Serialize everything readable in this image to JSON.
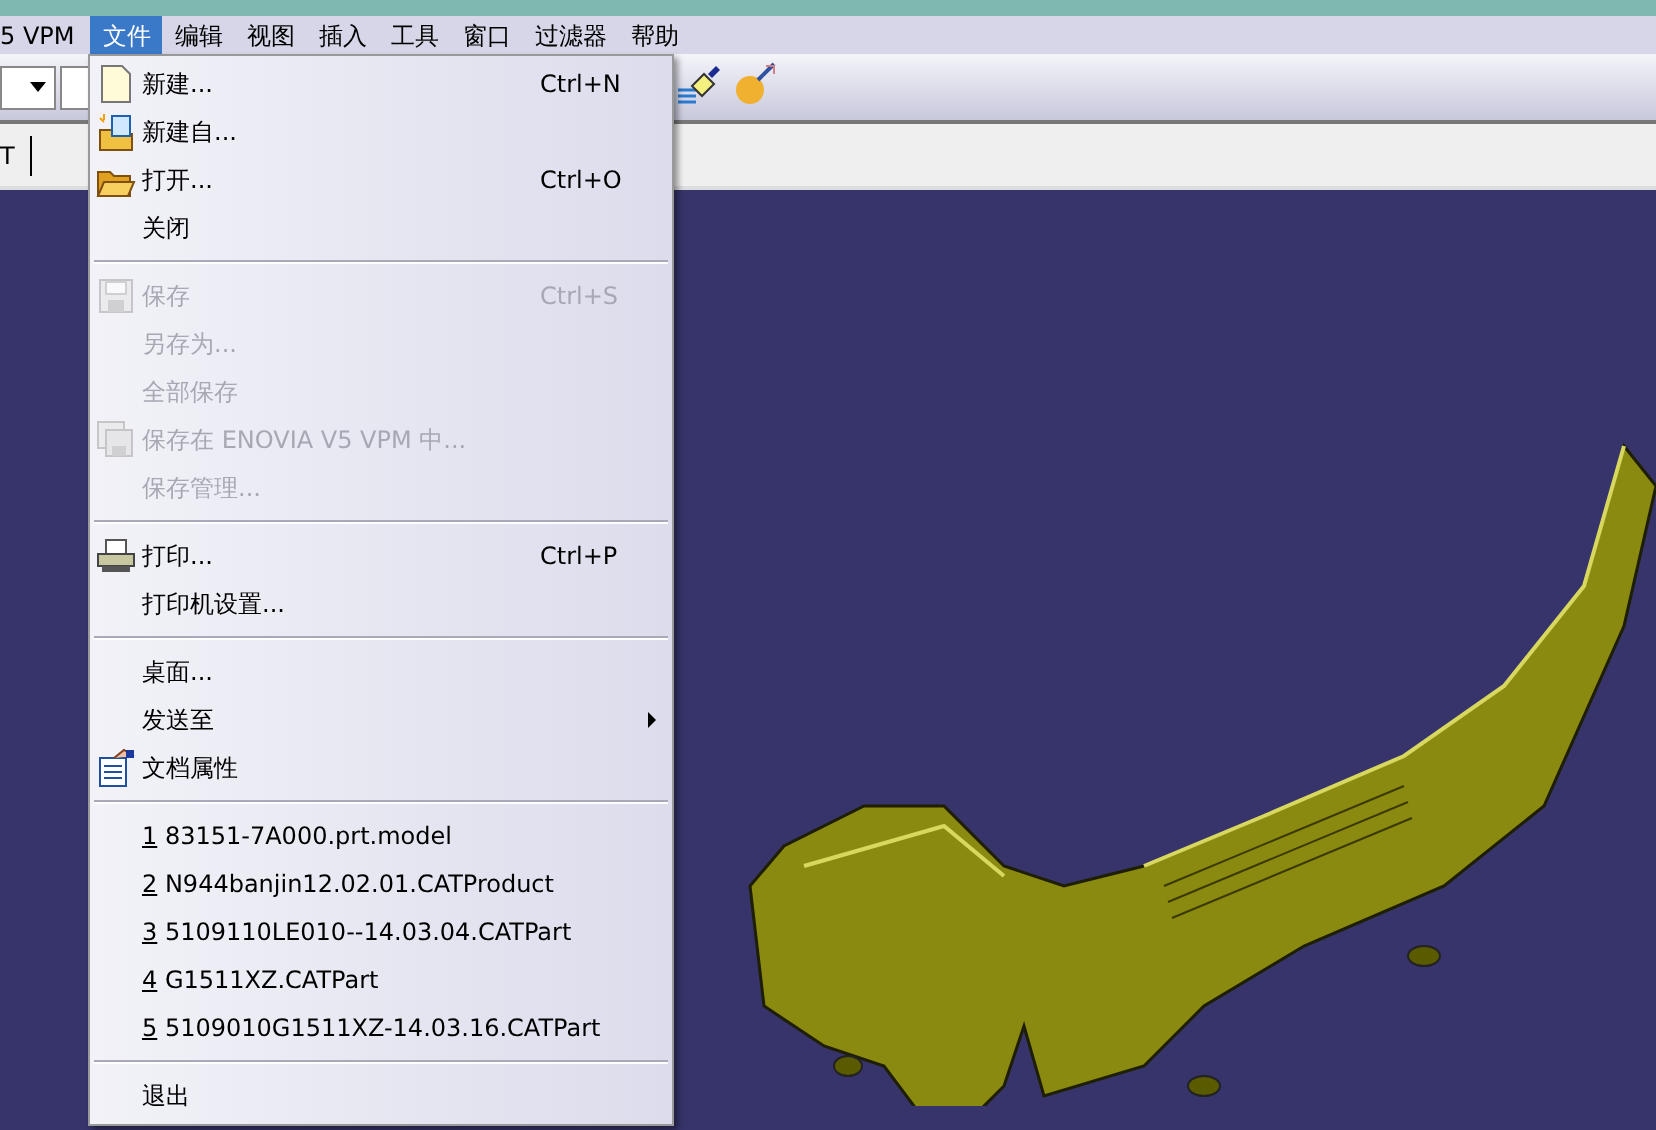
{
  "menu_bar": {
    "leading_text": "5 VPM",
    "menus": [
      {
        "label": "文件",
        "selected": true
      },
      {
        "label": "编辑",
        "selected": false
      },
      {
        "label": "视图",
        "selected": false
      },
      {
        "label": "插入",
        "selected": false
      },
      {
        "label": "工具",
        "selected": false
      },
      {
        "label": "窗口",
        "selected": false
      },
      {
        "label": "过滤器",
        "selected": false
      },
      {
        "label": "帮助",
        "selected": false
      }
    ]
  },
  "second_toolbar": {
    "text": "T"
  },
  "file_menu": {
    "items": [
      {
        "kind": "item",
        "label": "新建...",
        "shortcut": "Ctrl+N",
        "disabled": false
      },
      {
        "kind": "item",
        "label": "新建自...",
        "disabled": false
      },
      {
        "kind": "item",
        "label": "打开...",
        "shortcut": "Ctrl+O",
        "disabled": false
      },
      {
        "kind": "item",
        "label": "关闭",
        "disabled": false
      },
      {
        "kind": "separator"
      },
      {
        "kind": "item",
        "label": "保存",
        "shortcut": "Ctrl+S",
        "disabled": true
      },
      {
        "kind": "item",
        "label": "另存为...",
        "disabled": true
      },
      {
        "kind": "item",
        "label": "全部保存",
        "disabled": true
      },
      {
        "kind": "item",
        "label": "保存在 ENOVIA V5 VPM 中...",
        "disabled": true
      },
      {
        "kind": "item",
        "label": "保存管理...",
        "disabled": true
      },
      {
        "kind": "separator"
      },
      {
        "kind": "item",
        "label": "打印...",
        "shortcut": "Ctrl+P",
        "disabled": false
      },
      {
        "kind": "item",
        "label": "打印机设置...",
        "disabled": false
      },
      {
        "kind": "separator"
      },
      {
        "kind": "item",
        "label": "桌面...",
        "disabled": false
      },
      {
        "kind": "item",
        "label": "发送至",
        "submenu": true,
        "disabled": false
      },
      {
        "kind": "item",
        "label": "文档属性",
        "disabled": false
      },
      {
        "kind": "separator"
      },
      {
        "kind": "recent",
        "number": "1",
        "label": "83151-7A000.prt.model"
      },
      {
        "kind": "recent",
        "number": "2",
        "label": "N944banjin12.02.01.CATProduct"
      },
      {
        "kind": "recent",
        "number": "3",
        "label": "5109110LE010--14.03.04.CATPart"
      },
      {
        "kind": "recent",
        "number": "4",
        "label": "G1511XZ.CATPart"
      },
      {
        "kind": "recent",
        "number": "5",
        "label": "5109010G1511XZ-14.03.16.CATPart"
      },
      {
        "kind": "separator"
      },
      {
        "kind": "item",
        "label": "退出",
        "disabled": false
      }
    ]
  }
}
